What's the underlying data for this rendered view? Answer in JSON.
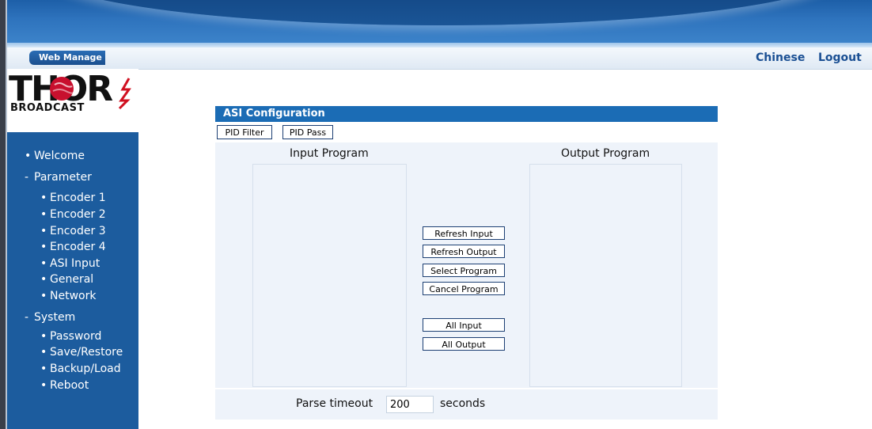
{
  "menubar": {
    "web_manage_tab": "Web Manage",
    "chinese_link": "Chinese",
    "logout_link": "Logout"
  },
  "logo": {
    "main": "THOR",
    "sub": "BROADCAST"
  },
  "sidebar": {
    "welcome": "Welcome",
    "parameter": "Parameter",
    "encoder1": "Encoder 1",
    "encoder2": "Encoder 2",
    "encoder3": "Encoder 3",
    "encoder4": "Encoder 4",
    "asi_input": "ASI Input",
    "general": "General",
    "network": "Network",
    "system": "System",
    "password": "Password",
    "save_restore": "Save/Restore",
    "backup_load": "Backup/Load",
    "reboot": "Reboot"
  },
  "panel": {
    "title": "ASI Configuration",
    "tab_pid_filter": "PID Filter",
    "tab_pid_pass": "PID Pass",
    "input_program_header": "Input Program",
    "output_program_header": "Output Program",
    "refresh_input": "Refresh Input",
    "refresh_output": "Refresh Output",
    "select_program": "Select Program",
    "cancel_program": "Cancel Program",
    "all_input": "All Input",
    "all_output": "All Output",
    "parse_timeout_label": "Parse timeout",
    "parse_timeout_value": "200",
    "seconds_label": "seconds"
  },
  "colors": {
    "sidebar_bg": "#1c5c9e",
    "panel_title_bg": "#1b6cb5",
    "link_color": "#1a4f93"
  }
}
